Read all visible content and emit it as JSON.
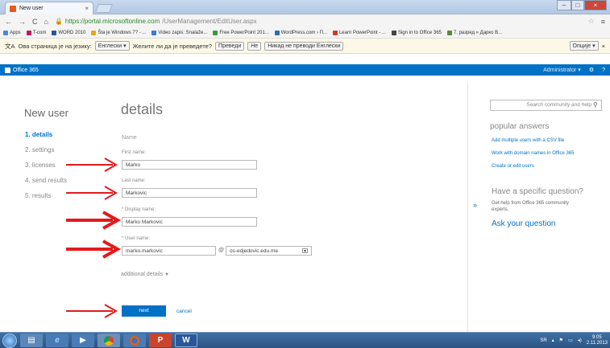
{
  "browser": {
    "tab_title": "New user",
    "url_host": "https://portal.microsoftonline.com",
    "url_path": "/UserManagement/EditUser.aspx",
    "bookmarks": [
      "Apps",
      "T-com",
      "WORD 2010",
      "Šta je Windows 7? - ...",
      "Video zapis: Snalaže...",
      "Free PowerPoint 201...",
      "WordPress.com › П...",
      "Learn PowerPoint - ...",
      "Sign in to Office 365",
      "7. разред » Дарко В..."
    ],
    "bookmark_colors": [
      "#4a8ad4",
      "#c2185b",
      "#2b579a",
      "#e6a817",
      "#3a7bd5",
      "#3a9a3a",
      "#2a6fb0",
      "#d03a2a",
      "#444444",
      "#5a8a3a"
    ]
  },
  "translate_bar": {
    "text1": "Ова страница је на језику:",
    "language": "Енглески",
    "text2": "Желите ли да је преведете?",
    "translate_btn": "Преведи",
    "no_btn": "Не",
    "never_btn": "Никад не преводи Енглески",
    "options_btn": "Опције"
  },
  "o365": {
    "title": "Office 365",
    "admin": "Administrator"
  },
  "wizard": {
    "title": "New user",
    "steps": [
      "1. details",
      "2. settings",
      "3. licenses",
      "4. send results",
      "5. results"
    ]
  },
  "form": {
    "heading": "details",
    "section_name": "Name",
    "first_name_label": "First name:",
    "first_name_value": "Marko",
    "last_name_label": "Last name:",
    "last_name_value": "Markovic",
    "display_name_label": "* Display name:",
    "display_name_value": "Marko Markovic",
    "user_name_label": "* User name:",
    "user_name_value": "marko.markovic",
    "at_sign": "@",
    "domain_value": "os-edjedovic.edu.me",
    "additional_details": "additional details",
    "next_btn": "next",
    "cancel_link": "cancel"
  },
  "side": {
    "search_placeholder": "Search community and help",
    "popular_heading": "popular answers",
    "links": [
      "Add multiple users with a CSV file",
      "Work with domain names in Office 365",
      "Create or edit users"
    ],
    "question_heading": "Have a specific question?",
    "question_help": "Get help from Office 365 community experts.",
    "ask_link": "Ask your question"
  },
  "taskbar": {
    "lang": "SR",
    "time": "9:05",
    "date": "2.11.2013"
  }
}
